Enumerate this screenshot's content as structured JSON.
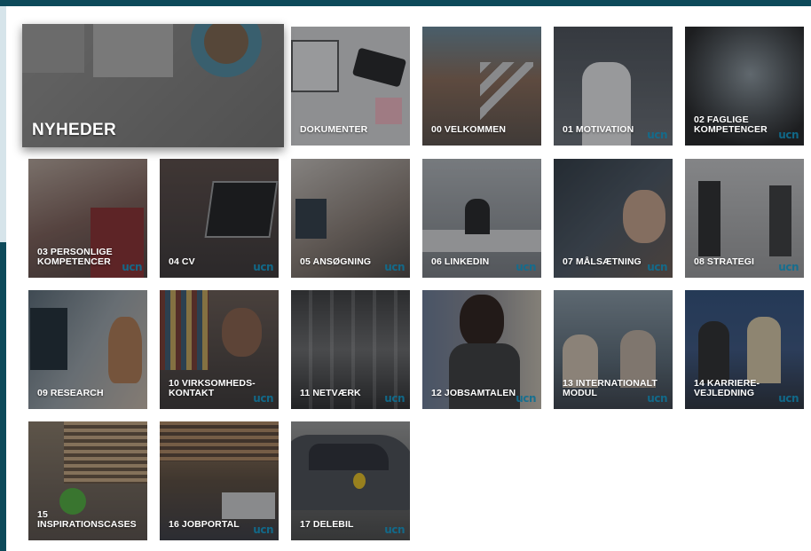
{
  "featured": {
    "label": "NYHEDER"
  },
  "logo_text": "ucn",
  "tiles": [
    {
      "label": "DOKUMENTER"
    },
    {
      "label": "00 VELKOMMEN"
    },
    {
      "label": "01 MOTIVATION"
    },
    {
      "label": "02 FAGLIGE\nKOMPETENCER"
    },
    {
      "label": "03 PERSONLIGE\nKOMPETENCER"
    },
    {
      "label": "04 CV"
    },
    {
      "label": "05 ANSØGNING"
    },
    {
      "label": "06 LINKEDIN"
    },
    {
      "label": "07 MÅLSÆTNING"
    },
    {
      "label": "08 STRATEGI"
    },
    {
      "label": "09 RESEARCH"
    },
    {
      "label": "10 VIRKSOMHEDS-\nKONTAKT"
    },
    {
      "label": "11 NETVÆRK"
    },
    {
      "label": "12 JOBSAMTALEN"
    },
    {
      "label": "13 INTERNATIONALT\nMODUL"
    },
    {
      "label": "14 KARRIERE-\nVEJLEDNING"
    },
    {
      "label": "15\nINSPIRATIONSCASES"
    },
    {
      "label": "16 JOBPORTAL"
    },
    {
      "label": "17 DELEBIL"
    }
  ],
  "colors": {
    "brand_dark": "#0d4a5a",
    "brand_light": "#d6e4ea",
    "logo": "#0f6f92"
  }
}
